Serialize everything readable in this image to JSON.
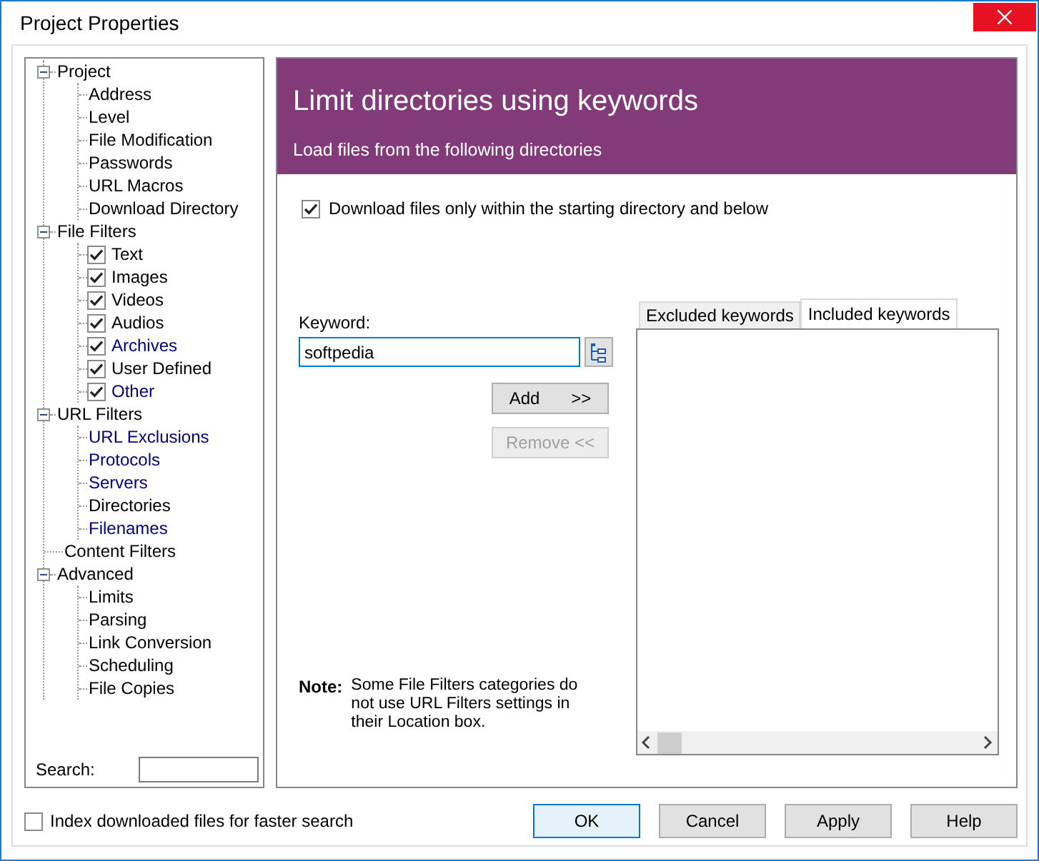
{
  "window": {
    "title": "Project Properties"
  },
  "tree": {
    "items": [
      {
        "label": "Project",
        "expanded": true,
        "children": [
          {
            "kind": "page",
            "label": "Address",
            "color": "#000000"
          },
          {
            "kind": "page",
            "label": "Level",
            "color": "#000000"
          },
          {
            "kind": "page",
            "label": "File Modification",
            "color": "#000000"
          },
          {
            "kind": "page",
            "label": "Passwords",
            "color": "#000000"
          },
          {
            "kind": "page",
            "label": "URL Macros",
            "color": "#000000"
          },
          {
            "kind": "page",
            "label": "Download Directory",
            "color": "#000000"
          }
        ]
      },
      {
        "label": "File Filters",
        "expanded": true,
        "children": [
          {
            "kind": "checkbox",
            "label": "Text",
            "checked": true,
            "color": "#000000"
          },
          {
            "kind": "checkbox",
            "label": "Images",
            "checked": true,
            "color": "#000000"
          },
          {
            "kind": "checkbox",
            "label": "Videos",
            "checked": true,
            "color": "#000000"
          },
          {
            "kind": "checkbox",
            "label": "Audios",
            "checked": true,
            "color": "#000000"
          },
          {
            "kind": "checkbox",
            "label": "Archives",
            "checked": true,
            "color": "#000080"
          },
          {
            "kind": "checkbox",
            "label": "User Defined",
            "checked": true,
            "color": "#000000"
          },
          {
            "kind": "checkbox",
            "label": "Other",
            "checked": true,
            "color": "#000080"
          }
        ]
      },
      {
        "label": "URL Filters",
        "expanded": true,
        "children": [
          {
            "kind": "page",
            "label": "URL Exclusions",
            "color": "#000080"
          },
          {
            "kind": "page",
            "label": "Protocols",
            "color": "#000080"
          },
          {
            "kind": "page",
            "label": "Servers",
            "color": "#000080"
          },
          {
            "kind": "page",
            "label": "Directories",
            "color": "#000000"
          },
          {
            "kind": "page",
            "label": "Filenames",
            "color": "#000080"
          }
        ]
      },
      {
        "label": "Content Filters"
      },
      {
        "label": "Advanced",
        "expanded": true,
        "children": [
          {
            "kind": "page",
            "label": "Limits",
            "color": "#000000"
          },
          {
            "kind": "page",
            "label": "Parsing",
            "color": "#000000"
          },
          {
            "kind": "page",
            "label": "Link Conversion",
            "color": "#000000"
          },
          {
            "kind": "page",
            "label": "Scheduling",
            "color": "#000000"
          },
          {
            "kind": "page",
            "label": "File Copies",
            "color": "#000000"
          }
        ]
      }
    ],
    "search": {
      "label": "Search:"
    }
  },
  "header": {
    "title": "Limit directories using keywords",
    "subtitle": "Load files from the following directories"
  },
  "option": {
    "label": "Download files only within the starting directory and below",
    "checked": true
  },
  "keyword": {
    "label": "Keyword:",
    "value": "softpedia"
  },
  "buttons": [
    {
      "label": "Add",
      "suffix": ">>",
      "disabled": false
    },
    {
      "label": "Remove <<",
      "disabled": true
    }
  ],
  "tabs": [
    {
      "label": "Excluded keywords",
      "selected": false
    },
    {
      "label": "Included keywords",
      "selected": true
    }
  ],
  "note": {
    "label": "Note:",
    "text": "Some File Filters categories do not use URL Filters settings in their Location box."
  },
  "index_option": {
    "label": "Index downloaded files for faster search",
    "checked": false
  },
  "dialog_buttons": [
    {
      "label": "OK",
      "default": true
    },
    {
      "label": "Cancel",
      "default": false
    },
    {
      "label": "Apply",
      "default": false
    },
    {
      "label": "Help",
      "default": false
    }
  ]
}
